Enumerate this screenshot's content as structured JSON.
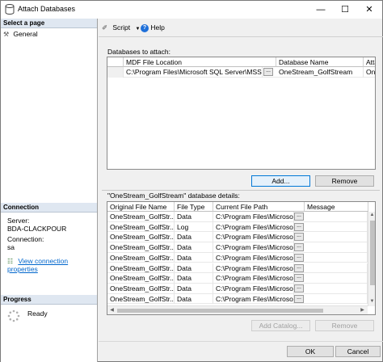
{
  "window": {
    "title": "Attach Databases",
    "minimize": "—",
    "maximize": "☐",
    "close": "✕"
  },
  "left": {
    "select_page": "Select a page",
    "pages": [
      "General"
    ],
    "connection_header": "Connection",
    "server_label": "Server:",
    "server_value": "BDA-CLACKPOUR",
    "connection_label": "Connection:",
    "connection_value": "sa",
    "view_props": "View connection properties",
    "progress_header": "Progress",
    "progress_status": "Ready"
  },
  "toolbar": {
    "script": "Script",
    "help": "Help"
  },
  "attach": {
    "label": "Databases to attach:",
    "columns": [
      "MDF File Location",
      "Database Name",
      "Atta"
    ],
    "rows": [
      {
        "mdf": "C:\\Program Files\\Microsoft SQL Server\\MSSQL...",
        "db": "OneStream_GolfStream",
        "att": "One"
      }
    ],
    "add_button": "Add...",
    "remove_button": "Remove"
  },
  "details": {
    "label": "\"OneStream_GolfStream\" database details:",
    "columns": [
      "Original File Name",
      "File Type",
      "Current File Path",
      "Message"
    ],
    "rows": [
      {
        "name": "OneStream_GolfStr...",
        "type": "Data",
        "path": "C:\\Program Files\\Microso..."
      },
      {
        "name": "OneStream_GolfStr...",
        "type": "Log",
        "path": "C:\\Program Files\\Microso..."
      },
      {
        "name": "OneStream_GolfStr...",
        "type": "Data",
        "path": "C:\\Program Files\\Microso..."
      },
      {
        "name": "OneStream_GolfStr...",
        "type": "Data",
        "path": "C:\\Program Files\\Microso..."
      },
      {
        "name": "OneStream_GolfStr...",
        "type": "Data",
        "path": "C:\\Program Files\\Microso..."
      },
      {
        "name": "OneStream_GolfStr...",
        "type": "Data",
        "path": "C:\\Program Files\\Microso..."
      },
      {
        "name": "OneStream_GolfStr...",
        "type": "Data",
        "path": "C:\\Program Files\\Microso..."
      },
      {
        "name": "OneStream_GolfStr...",
        "type": "Data",
        "path": "C:\\Program Files\\Microso..."
      },
      {
        "name": "OneStream_GolfStr...",
        "type": "Data",
        "path": "C:\\Program Files\\Microso..."
      }
    ],
    "ellipsis": "...",
    "add_catalog_button": "Add Catalog...",
    "remove_button": "Remove"
  },
  "footer": {
    "ok": "OK",
    "cancel": "Cancel"
  },
  "colors": {
    "accent": "#0078d7",
    "link": "#0066cc",
    "section_header": "#dfe7f1"
  }
}
